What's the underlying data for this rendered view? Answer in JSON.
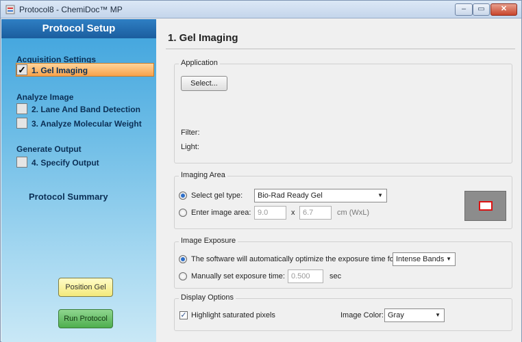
{
  "window": {
    "title": "Protocol8 - ChemiDoc™ MP",
    "minimize_label": "–",
    "maximize_label": "▭",
    "close_label": "✕"
  },
  "sidebar": {
    "header": "Protocol Setup",
    "sections": [
      {
        "title": "Acquisition Settings",
        "items": [
          {
            "label": "1. Gel Imaging",
            "checked": true,
            "active": true
          }
        ]
      },
      {
        "title": "Analyze Image",
        "items": [
          {
            "label": "2. Lane And Band Detection",
            "checked": false
          },
          {
            "label": "3. Analyze Molecular Weight",
            "checked": false
          }
        ]
      },
      {
        "title": "Generate Output",
        "items": [
          {
            "label": "4. Specify Output",
            "checked": false
          }
        ]
      }
    ],
    "check_mark": "✓",
    "summary": "Protocol Summary",
    "position_gel_label": "Position Gel",
    "run_protocol_label": "Run Protocol"
  },
  "main": {
    "title": "1. Gel Imaging",
    "application": {
      "title": "Application",
      "select_label": "Select...",
      "filter_label": "Filter:",
      "light_label": "Light:"
    },
    "imaging_area": {
      "title": "Imaging Area",
      "select_gel_type_label": "Select gel type:",
      "gel_type_value": "Bio-Rad Ready Gel",
      "enter_image_area_label": "Enter image area:",
      "width_value": "9.0",
      "x_label": "x",
      "length_value": "6.7",
      "unit_label": "cm (WxL)",
      "selected": "gel-type"
    },
    "image_exposure": {
      "title": "Image Exposure",
      "auto_label": "The software will automatically optimize the exposure time for",
      "auto_value": "Intense Bands",
      "manual_label": "Manually set exposure time:",
      "manual_value": "0.500",
      "sec_label": "sec",
      "selected": "auto"
    },
    "display_options": {
      "title": "Display Options",
      "highlight_label": "Highlight saturated pixels",
      "highlight_checked": true,
      "image_color_label": "Image Color:",
      "image_color_value": "Gray"
    }
  },
  "colors": {
    "sidebar_active": "#f7a24b",
    "run_button": "#4eae4e",
    "position_button": "#f3e97a",
    "radio_selected": "#2d6fc9"
  }
}
